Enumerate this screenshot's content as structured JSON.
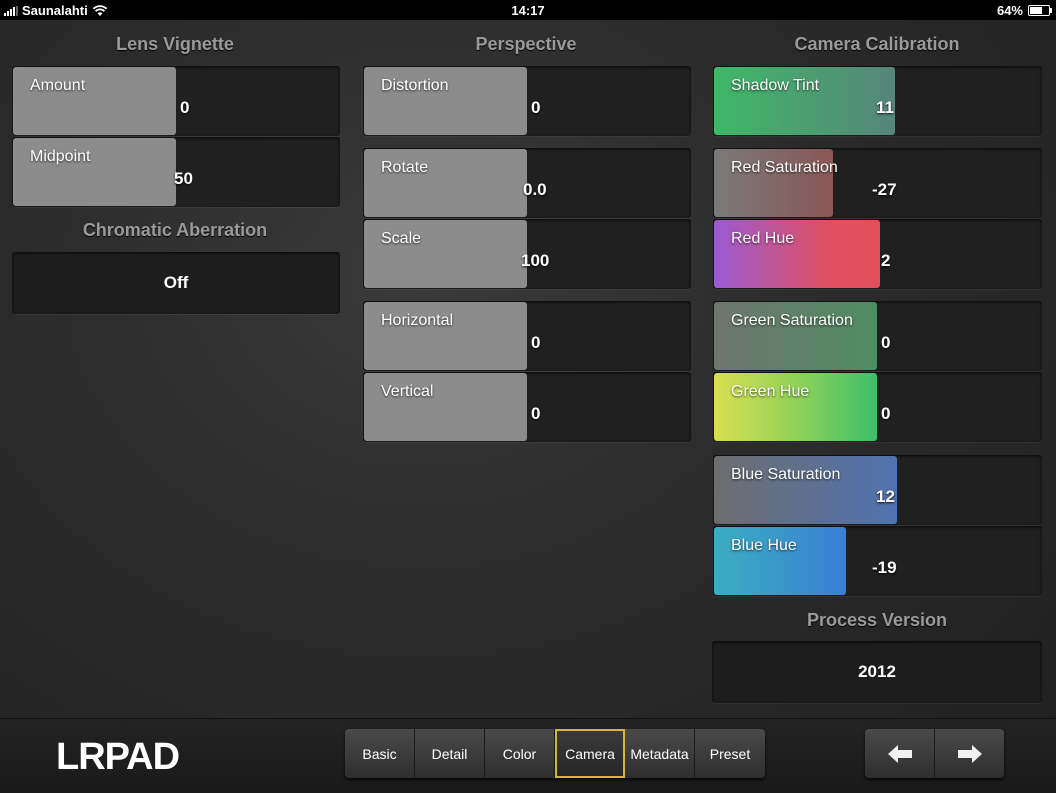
{
  "status": {
    "carrier": "Saunalahti",
    "time": "14:17",
    "battery": "64%"
  },
  "sections": {
    "lens_vignette": "Lens Vignette",
    "chromatic_aberration": "Chromatic Aberration",
    "perspective": "Perspective",
    "camera_calibration": "Camera Calibration",
    "process_version": "Process Version"
  },
  "lens_vignette": {
    "amount": {
      "label": "Amount",
      "value": "0"
    },
    "midpoint": {
      "label": "Midpoint",
      "value": "50"
    }
  },
  "chromatic_aberration": {
    "value": "Off"
  },
  "perspective": {
    "distortion": {
      "label": "Distortion",
      "value": "0"
    },
    "rotate": {
      "label": "Rotate",
      "value": "0.0"
    },
    "scale": {
      "label": "Scale",
      "value": "100"
    },
    "horizontal": {
      "label": "Horizontal",
      "value": "0"
    },
    "vertical": {
      "label": "Vertical",
      "value": "0"
    }
  },
  "camera_calibration": {
    "shadow_tint": {
      "label": "Shadow Tint",
      "value": "11"
    },
    "red_saturation": {
      "label": "Red Saturation",
      "value": "-27"
    },
    "red_hue": {
      "label": "Red Hue",
      "value": "2"
    },
    "green_saturation": {
      "label": "Green Saturation",
      "value": "0"
    },
    "green_hue": {
      "label": "Green Hue",
      "value": "0"
    },
    "blue_saturation": {
      "label": "Blue Saturation",
      "value": "12"
    },
    "blue_hue": {
      "label": "Blue Hue",
      "value": "-19"
    }
  },
  "process_version": {
    "value": "2012"
  },
  "logo": "LRPAD",
  "tabs": [
    {
      "label": "Basic"
    },
    {
      "label": "Detail"
    },
    {
      "label": "Color"
    },
    {
      "label": "Camera",
      "active": true
    },
    {
      "label": "Metadata"
    },
    {
      "label": "Preset"
    }
  ],
  "nav": {
    "prev_icon": "arrow-left-icon",
    "next_icon": "arrow-right-icon"
  },
  "colors": {
    "accent": "#d4b63a"
  }
}
